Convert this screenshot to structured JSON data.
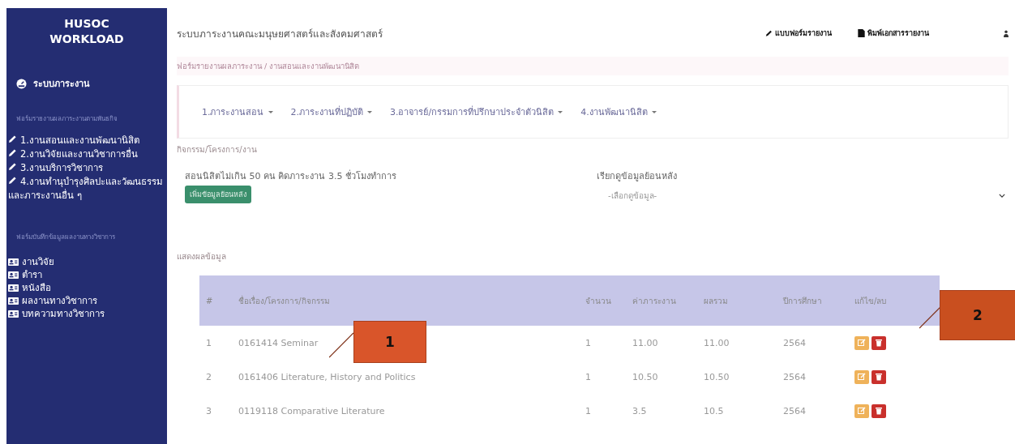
{
  "sidebar": {
    "brand": [
      "HUSOC",
      "WORKLOAD"
    ],
    "home": "ระบบภาระงาน",
    "section_1": "ฟอร์มรายงานผลภาระงานตามพันธกิจ",
    "forms": [
      "1.งานสอนและงานพัฒนานิสิต",
      "2.งานวิจัยและงานวิชาการอื่น",
      "3.งานบริการวิชาการ",
      "4.งานทำนุบำรุงศิลปะและวัฒนธรรมและภาระงานอื่น ๆ"
    ],
    "section_2": "ฟอร์มบันทึกข้อมูลผลงานทางวิชาการ",
    "records": [
      "งานวิจัย",
      "ตำรา",
      "หนังสือ",
      "ผลงานทางวิชาการ",
      "บทความทางวิชาการ"
    ]
  },
  "topbar": {
    "title": "ระบบภาระงานคณะมนุษยศาสตร์และสังคมศาสตร์",
    "links": [
      {
        "kind": "pencil",
        "label": "แบบฟอร์มรายงาน"
      },
      {
        "kind": "file",
        "label": "พิมพ์เอกสารรายงาน"
      }
    ]
  },
  "breadcrumb": "ฟอร์มรายงานผลภาระงาน / งานสอนและงานพัฒนานิสิต",
  "tabs": [
    "1.ภาระงานสอน",
    "2.ภาระงานที่ปฏิบัติ",
    "3.อาจารย์/กรรมการที่ปรึกษาประจำตัวนิสิต",
    "4.งานพัฒนานิสิต"
  ],
  "activity": {
    "heading": "กิจกรรม/โครงการ/งาน",
    "description": "สอนนิสิตไม่เกิน 50 คน คิดภาระงาน 3.5 ชั่วโมงทำการ",
    "button": "เพิ่มข้อมูลย้อนหลัง",
    "history_label": "เรียกดูข้อมูลย้อนหลัง",
    "history_placeholder": "-เลือกดูข้อมูล-"
  },
  "results": {
    "heading": "แสดงผลข้อมูล",
    "columns": [
      "#",
      "ชื่อเรื่อง/โครงการ/กิจกรรม",
      "จำนวน",
      "ค่าภาระงาน",
      "ผลรวม",
      "ปีการศึกษา",
      "แก้ไข/ลบ"
    ],
    "rows": [
      {
        "no": "1",
        "title": "0161414 Seminar",
        "count": "1",
        "load": "11.00",
        "total": "11.00",
        "year": "2564"
      },
      {
        "no": "2",
        "title": "0161406 Literature, History and Politics",
        "count": "1",
        "load": "10.50",
        "total": "10.50",
        "year": "2564"
      },
      {
        "no": "3",
        "title": "0119118 Comparative Literature",
        "count": "1",
        "load": "3.5",
        "total": "10.5",
        "year": "2564"
      }
    ]
  },
  "callouts": [
    {
      "label": "1"
    },
    {
      "label": "2"
    }
  ]
}
